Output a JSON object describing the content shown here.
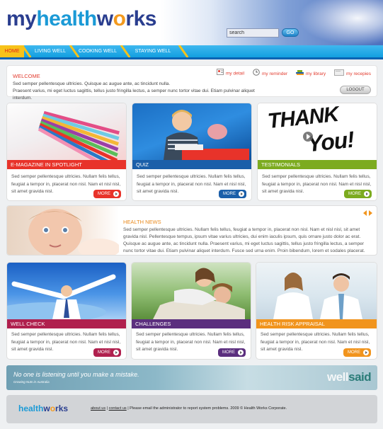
{
  "header": {
    "logo": {
      "my": "my",
      "health": "health",
      "w": "w",
      "o": "o",
      "rks": "rks"
    },
    "search_value": "search",
    "go_label": "GO"
  },
  "nav": {
    "items": [
      {
        "label": "HOME",
        "active": true
      },
      {
        "label": "LIVING WELL",
        "active": false
      },
      {
        "label": "COOKING WELL",
        "active": false
      },
      {
        "label": "STAYING WELL",
        "active": false
      }
    ]
  },
  "welcome": {
    "title": "WELCOME",
    "line1": "Sed semper pellentesque ultricies. Quisque ac augue ante, ac tincidunt nulla.",
    "line2": "Praesent varius, mi eget luctus sagittis, tellus justo fringilla lectus, a semper nunc tortor vitae dui. Etiam pulvinar aliquet interdum.",
    "quick_links": [
      "my detail",
      "my reminder",
      "my library",
      "my recepies"
    ],
    "logout_label": "LOGOUT"
  },
  "cards_row1": [
    {
      "title": "E-MAGAZINE IN SPOTLIGHT",
      "color": "#e8332a",
      "text": "Sed semper pellentesque ultricies. Nullam felis tellus, feugiat a tempor in, placerat non nisl. Nam et nisl nisl, sit amet gravida nisl.",
      "more": "MORE"
    },
    {
      "title": "QUIZ",
      "color": "#1b5fa9",
      "text": "Sed semper pellentesque ultricies. Nullam felis tellus, feugiat a tempor in, placerat non nisl. Nam et nisl nisl, sit amet gravida nisl.",
      "more": "MORE"
    },
    {
      "title": "TESTIMONIALS",
      "color": "#7cab1f",
      "text": "Sed semper pellentesque ultricies. Nullam felis tellus, feugiat a tempor in, placerat non nisl. Nam et nisl nisl, sit amet gravida nisl.",
      "more": "MORE"
    }
  ],
  "thank_you": {
    "line1": "THANK",
    "line2": "You!"
  },
  "news": {
    "title": "HEALTH NEWS",
    "text": "Sed semper pellentesque ultricies. Nullam felis tellus, feugiat a tempor in, placerat non nisl. Nam et nisl nisl, sit amet gravida nisl. Pellentesque tempus, ipsum vitae varius ultricies, dui enim iaculis ipsum, quis ornare justo dolor ac erat. Quisque ac augue ante, ac tincidunt nulla. Praesent varius, mi eget luctus sagittis, tellus justo fringilla lectus, a semper nunc tortor vitae dui. Etiam pulvinar aliquet interdum. Fusce sed urna enim. Proin bibendum, lorem et sodales placerat."
  },
  "cards_row2": [
    {
      "title": "WELL CHECK",
      "color": "#b0204e",
      "text": "Sed semper pellentesque ultricies. Nullam felis tellus, feugiat a tempor in, placerat non nisl. Nam et nisl nisl, sit amet gravida nisl.",
      "more": "MORE"
    },
    {
      "title": "CHALLENGES",
      "color": "#5b2e7e",
      "text": "Sed semper pellentesque ultricies. Nullam felis tellus, feugiat a tempor in, placerat non nisl. Nam et nisl nisl, sit amet gravida nisl.",
      "more": "MORE"
    },
    {
      "title": "HEALTH RISK APPRAISAL",
      "color": "#f1941d",
      "text": "Sed semper pellentesque ultricies. Nullam felis tellus, feugiat a tempor in, placerat non nisl. Nam et nisl nisl, sit amet gravida nisl.",
      "more": "MORE"
    }
  ],
  "banner": {
    "quote": "No one is listening until you make a mistake.",
    "sub": "Growing Nuts in Australia",
    "brand_well": "well",
    "brand_said": "said"
  },
  "footer": {
    "logo_health": "health",
    "logo_w": "w",
    "logo_o": "o",
    "logo_rks": "rks",
    "about_link": "about us",
    "contact_link": "contact us",
    "text": " Please email the administrator to report system problems. 2009 © Health Works Corporate."
  }
}
